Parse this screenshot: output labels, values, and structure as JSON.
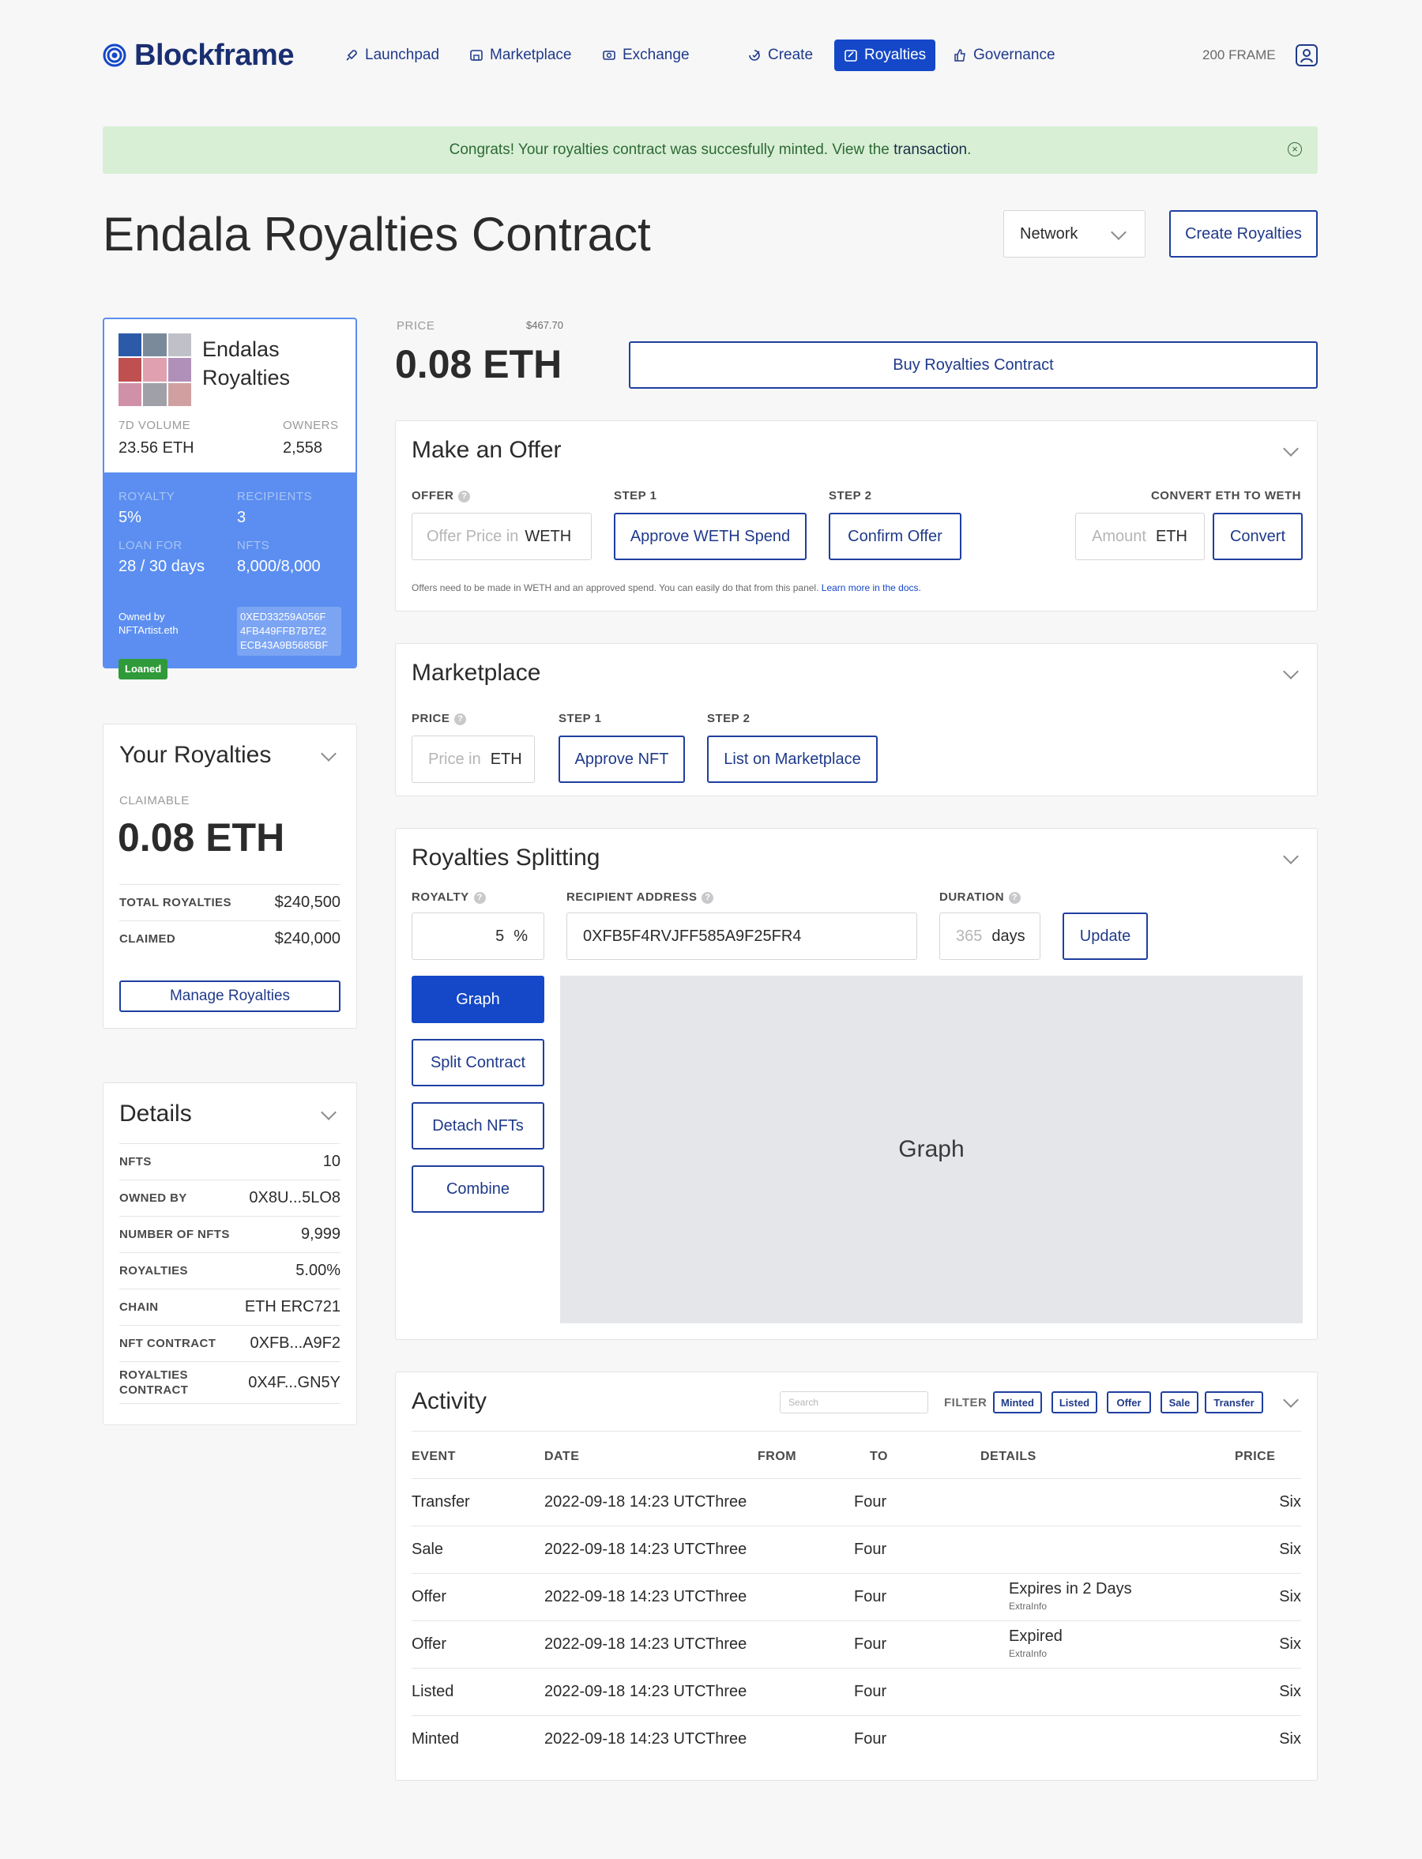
{
  "brand": {
    "name": "Blockframe"
  },
  "nav": {
    "items": [
      {
        "label": "Launchpad"
      },
      {
        "label": "Marketplace"
      },
      {
        "label": "Exchange"
      },
      {
        "label": "Create"
      },
      {
        "label": "Royalties"
      },
      {
        "label": "Governance"
      }
    ],
    "active": "Royalties",
    "balance": "200 FRAME"
  },
  "banner": {
    "text": "Congrats! Your royalties contract was succesfully minted. View the ",
    "link": "transaction",
    "end": "."
  },
  "page": {
    "title": "Endala Royalties Contract",
    "network_label": "Network",
    "create_button": "Create Royalties"
  },
  "nft_card": {
    "name_line1": "Endalas",
    "name_line2": "Royalties",
    "volume_label": "7D VOLUME",
    "volume_value": "23.56 ETH",
    "owners_label": "OWNERS",
    "owners_value": "2,558",
    "royalty_label": "ROYALTY",
    "royalty_value": "5%",
    "recipients_label": "RECIPIENTS",
    "recipients_value": "3",
    "loan_label": "LOAN FOR",
    "loan_value": "28 / 30 days",
    "nfts_label": "NFTS",
    "nfts_value": "8,000/8,000",
    "owned_by_label": "Owned by",
    "owned_by_value": "NFTArtist.eth",
    "address_line1": "0XED33259A056F",
    "address_line2": "4FB449FFB7B7E2",
    "address_line3": "ECB43A9B5685BF",
    "badge": "Loaned"
  },
  "your_royalties": {
    "title": "Your Royalties",
    "claimable_label": "CLAIMABLE",
    "claimable_value": "0.08 ETH",
    "rows": [
      {
        "k": "TOTAL ROYALTIES",
        "v": "$240,500"
      },
      {
        "k": "CLAIMED",
        "v": "$240,000"
      }
    ],
    "button": "Manage Royalties"
  },
  "details": {
    "title": "Details",
    "rows": [
      {
        "k": "NFTS",
        "v": "10"
      },
      {
        "k": "OWNED BY",
        "v": "0X8U...5LO8"
      },
      {
        "k": "NUMBER OF NFTS",
        "v": "9,999"
      },
      {
        "k": "ROYALTIES",
        "v": "5.00%"
      },
      {
        "k": "CHAIN",
        "v": "ETH ERC721"
      },
      {
        "k": "NFT CONTRACT",
        "v": "0XFB...A9F2"
      },
      {
        "k": "ROYALTIES CONTRACT",
        "v": "0X4F...GN5Y"
      }
    ]
  },
  "price": {
    "label": "PRICE",
    "usd": "$467.70",
    "value": "0.08 ETH",
    "buy_button": "Buy Royalties Contract"
  },
  "offer": {
    "title": "Make an Offer",
    "offer_label": "OFFER",
    "offer_placeholder": "Offer Price in",
    "offer_unit": "WETH",
    "step1_label": "STEP 1",
    "step1_button": "Approve WETH Spend",
    "step2_label": "STEP 2",
    "step2_button": "Confirm Offer",
    "convert_label": "CONVERT ETH TO WETH",
    "amount_placeholder": "Amount",
    "amount_unit": "ETH",
    "convert_button": "Convert",
    "note": "Offers need to be made in WETH and an approved spend. You can easily do that from this panel. ",
    "note_link": "Learn more in the docs."
  },
  "marketplace": {
    "title": "Marketplace",
    "price_label": "PRICE",
    "price_placeholder": "Price in",
    "price_unit": "ETH",
    "step1_label": "STEP 1",
    "step1_button": "Approve NFT",
    "step2_label": "STEP 2",
    "step2_button": "List on Marketplace"
  },
  "splitting": {
    "title": "Royalties Splitting",
    "royalty_label": "ROYALTY",
    "royalty_value": "5",
    "royalty_unit": "%",
    "recipient_label": "RECIPIENT ADDRESS",
    "recipient_value": "0XFB5F4RVJFF585A9F25FR4",
    "duration_label": "DURATION",
    "duration_placeholder": "365",
    "duration_unit": "days",
    "update_button": "Update",
    "actions": [
      "Graph",
      "Split Contract",
      "Detach NFTs",
      "Combine"
    ],
    "graph_label": "Graph"
  },
  "activity": {
    "title": "Activity",
    "search_placeholder": "Search",
    "filter_label": "FILTER",
    "filters": [
      "Minted",
      "Listed",
      "Offer",
      "Sale",
      "Transfer"
    ],
    "columns": [
      "EVENT",
      "DATE",
      "FROM",
      "TO",
      "DETAILS",
      "PRICE"
    ],
    "rows": [
      {
        "event": "Transfer",
        "date": "2022-09-18 14:23 UTC",
        "from": "Three",
        "to": "Four",
        "details": "",
        "extra": "",
        "price": "Six"
      },
      {
        "event": "Sale",
        "date": "2022-09-18 14:23 UTC",
        "from": "Three",
        "to": "Four",
        "details": "",
        "extra": "",
        "price": "Six"
      },
      {
        "event": "Offer",
        "date": "2022-09-18 14:23 UTC",
        "from": "Three",
        "to": "Four",
        "details": "Expires in 2 Days",
        "extra": "ExtraInfo",
        "price": "Six"
      },
      {
        "event": "Offer",
        "date": "2022-09-18 14:23 UTC",
        "from": "Three",
        "to": "Four",
        "details": "Expired",
        "extra": "ExtraInfo",
        "price": "Six"
      },
      {
        "event": "Listed",
        "date": "2022-09-18 14:23 UTC",
        "from": "Three",
        "to": "Four",
        "details": "",
        "extra": "",
        "price": "Six"
      },
      {
        "event": "Minted",
        "date": "2022-09-18 14:23 UTC",
        "from": "Three",
        "to": "Four",
        "details": "",
        "extra": "",
        "price": "Six"
      }
    ]
  },
  "colors": {
    "primary": "#1448c8",
    "banner_bg": "#d8efd5",
    "card_blue": "#5b8ef0",
    "badge_green": "#2f9a3a"
  }
}
